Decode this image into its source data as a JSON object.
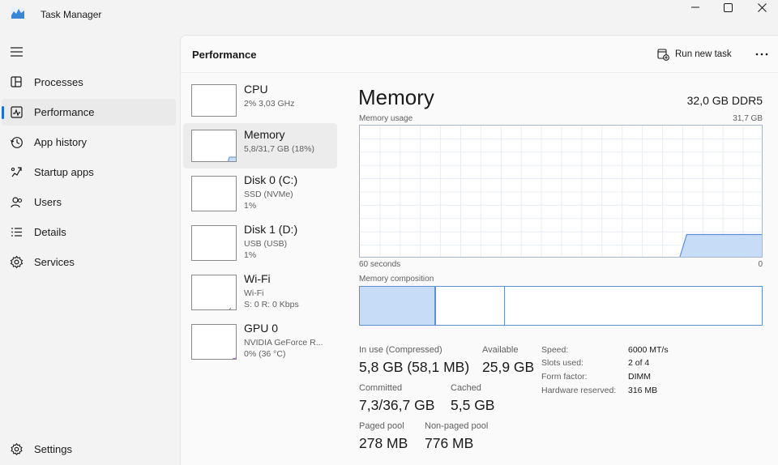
{
  "window": {
    "title": "Task Manager",
    "controls": [
      "minimize-icon",
      "maximize-icon",
      "close-icon"
    ]
  },
  "nav": {
    "items": [
      {
        "label": "Processes",
        "icon": "processes-icon"
      },
      {
        "label": "Performance",
        "icon": "performance-icon",
        "active": true
      },
      {
        "label": "App history",
        "icon": "app-history-icon"
      },
      {
        "label": "Startup apps",
        "icon": "startup-apps-icon"
      },
      {
        "label": "Users",
        "icon": "users-icon"
      },
      {
        "label": "Details",
        "icon": "details-icon"
      },
      {
        "label": "Services",
        "icon": "services-icon"
      }
    ],
    "settings": "Settings"
  },
  "header": {
    "title": "Performance",
    "run_new_task": "Run new task"
  },
  "devices": [
    {
      "name": "CPU",
      "line1": "2% 3,03 GHz",
      "line2": ""
    },
    {
      "name": "Memory",
      "line1": "5,8/31,7 GB (18%)",
      "line2": ""
    },
    {
      "name": "Disk 0 (C:)",
      "line1": "SSD (NVMe)",
      "line2": "1%"
    },
    {
      "name": "Disk 1 (D:)",
      "line1": "USB (USB)",
      "line2": "1%"
    },
    {
      "name": "Wi-Fi",
      "line1": "Wi-Fi",
      "line2": "S: 0 R: 0 Kbps"
    },
    {
      "name": "GPU 0",
      "line1": "NVIDIA GeForce R...",
      "line2": "0% (36 °C)"
    }
  ],
  "memory": {
    "title": "Memory",
    "total": "32,0 GB DDR5",
    "usage_label": "Memory usage",
    "usage_max": "31,7 GB",
    "time_span": "60 seconds",
    "time_end": "0",
    "usage_fraction": 0.18,
    "composition_label": "Memory composition",
    "composition_fractions": {
      "in_use": 0.188,
      "modified": 0.172,
      "standby_free": 0.64
    },
    "colors": {
      "fill": "#c7dcf7",
      "line": "#5d8ed6"
    },
    "stats": {
      "in_use_label": "In use (Compressed)",
      "in_use_value": "5,8 GB (58,1 MB)",
      "available_label": "Available",
      "available_value": "25,9 GB",
      "committed_label": "Committed",
      "committed_value": "7,3/36,7 GB",
      "cached_label": "Cached",
      "cached_value": "5,5 GB",
      "paged_label": "Paged pool",
      "paged_value": "278 MB",
      "nonpaged_label": "Non-paged pool",
      "nonpaged_value": "776 MB"
    },
    "details": [
      {
        "key": "Speed:",
        "value": "6000 MT/s"
      },
      {
        "key": "Slots used:",
        "value": "2 of 4"
      },
      {
        "key": "Form factor:",
        "value": "DIMM"
      },
      {
        "key": "Hardware reserved:",
        "value": "316 MB"
      }
    ]
  }
}
